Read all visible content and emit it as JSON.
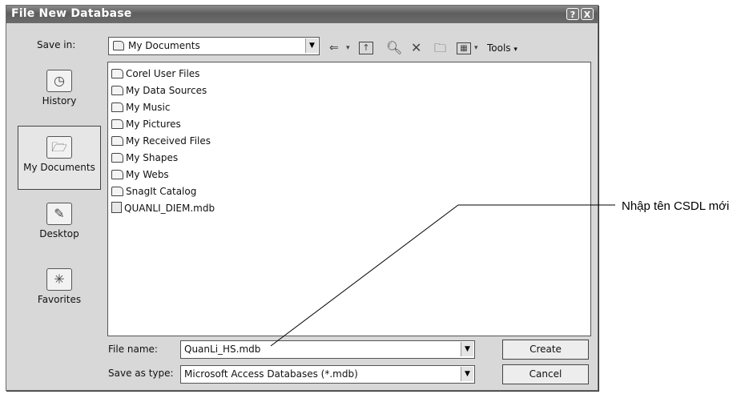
{
  "dialog": {
    "title": "File New Database",
    "help_label": "?",
    "close_label": "X"
  },
  "save_in": {
    "label": "Save in:",
    "value": "My Documents"
  },
  "toolbar": {
    "tools_label": "Tools"
  },
  "places": [
    {
      "label": "History"
    },
    {
      "label": "My Documents"
    },
    {
      "label": "Desktop"
    },
    {
      "label": "Favorites"
    }
  ],
  "files": [
    {
      "name": "Corel User Files",
      "kind": "folder"
    },
    {
      "name": "My Data Sources",
      "kind": "folder"
    },
    {
      "name": "My Music",
      "kind": "folder"
    },
    {
      "name": "My Pictures",
      "kind": "folder"
    },
    {
      "name": "My Received Files",
      "kind": "folder"
    },
    {
      "name": "My Shapes",
      "kind": "folder"
    },
    {
      "name": "My Webs",
      "kind": "folder"
    },
    {
      "name": "SnagIt Catalog",
      "kind": "folder"
    },
    {
      "name": "QUANLI_DIEM.mdb",
      "kind": "database"
    }
  ],
  "file_name": {
    "label": "File name:",
    "value": "QuanLi_HS.mdb"
  },
  "save_as_type": {
    "label": "Save as type:",
    "value": "Microsoft Access Databases (*.mdb)"
  },
  "buttons": {
    "create": "Create",
    "cancel": "Cancel"
  },
  "annotation": {
    "text": "Nhập tên CSDL mới"
  }
}
